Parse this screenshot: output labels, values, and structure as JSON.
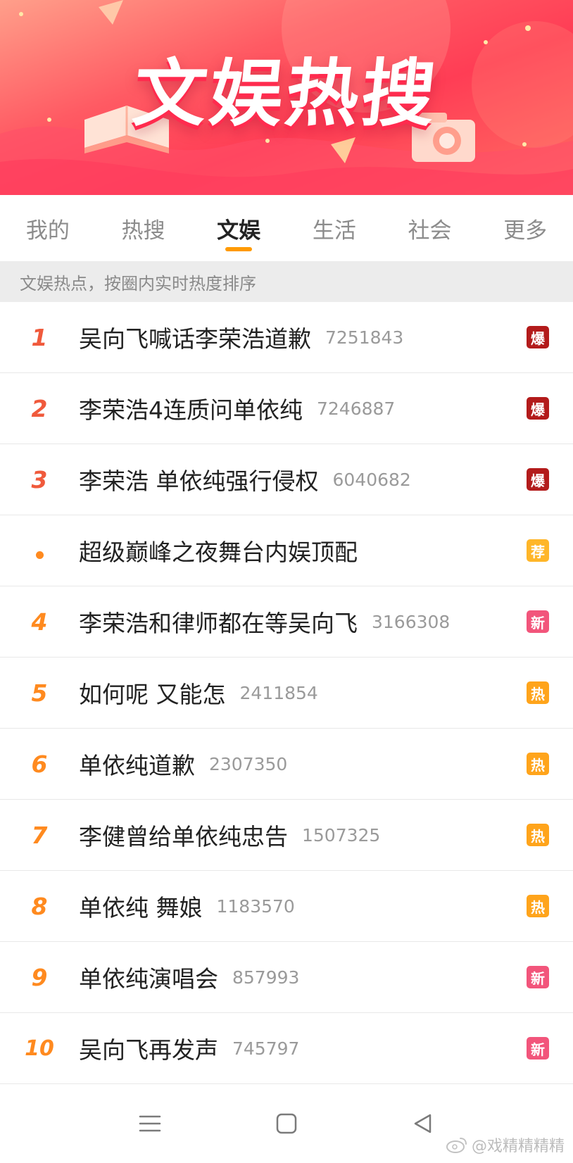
{
  "banner": {
    "title": "文娱热搜"
  },
  "tabs": [
    {
      "label": "我的",
      "active": false
    },
    {
      "label": "热搜",
      "active": false
    },
    {
      "label": "文娱",
      "active": true
    },
    {
      "label": "生活",
      "active": false
    },
    {
      "label": "社会",
      "active": false
    },
    {
      "label": "更多",
      "active": false
    }
  ],
  "notice": "文娱热点，按圈内实时热度排序",
  "list": [
    {
      "rank": "1",
      "title": "吴向飞喊话李荣浩道歉",
      "count": "7251843",
      "badge": "爆",
      "badge_color": "#b31b1b"
    },
    {
      "rank": "2",
      "title": "李荣浩4连质问单依纯",
      "count": "7246887",
      "badge": "爆",
      "badge_color": "#b31b1b"
    },
    {
      "rank": "3",
      "title": "李荣浩 单依纯强行侵权",
      "count": "6040682",
      "badge": "爆",
      "badge_color": "#b31b1b"
    },
    {
      "rank": "",
      "title": "超级巅峰之夜舞台内娱顶配",
      "count": "",
      "badge": "荐",
      "badge_color": "#ffb629"
    },
    {
      "rank": "4",
      "title": "李荣浩和律师都在等吴向飞",
      "count": "3166308",
      "badge": "新",
      "badge_color": "#f2557b"
    },
    {
      "rank": "5",
      "title": "如何呢 又能怎",
      "count": "2411854",
      "badge": "热",
      "badge_color": "#ffa41b"
    },
    {
      "rank": "6",
      "title": "单依纯道歉",
      "count": "2307350",
      "badge": "热",
      "badge_color": "#ffa41b"
    },
    {
      "rank": "7",
      "title": "李健曾给单依纯忠告",
      "count": "1507325",
      "badge": "热",
      "badge_color": "#ffa41b"
    },
    {
      "rank": "8",
      "title": "单依纯 舞娘",
      "count": "1183570",
      "badge": "热",
      "badge_color": "#ffa41b"
    },
    {
      "rank": "9",
      "title": "单依纯演唱会",
      "count": "857993",
      "badge": "新",
      "badge_color": "#f2557b"
    },
    {
      "rank": "10",
      "title": "吴向飞再发声",
      "count": "745797",
      "badge": "新",
      "badge_color": "#f2557b"
    }
  ],
  "navbar": {
    "menu_icon": "menu-icon",
    "home_icon": "home-square-icon",
    "back_icon": "back-triangle-icon"
  },
  "watermark": "@戏精精精精"
}
